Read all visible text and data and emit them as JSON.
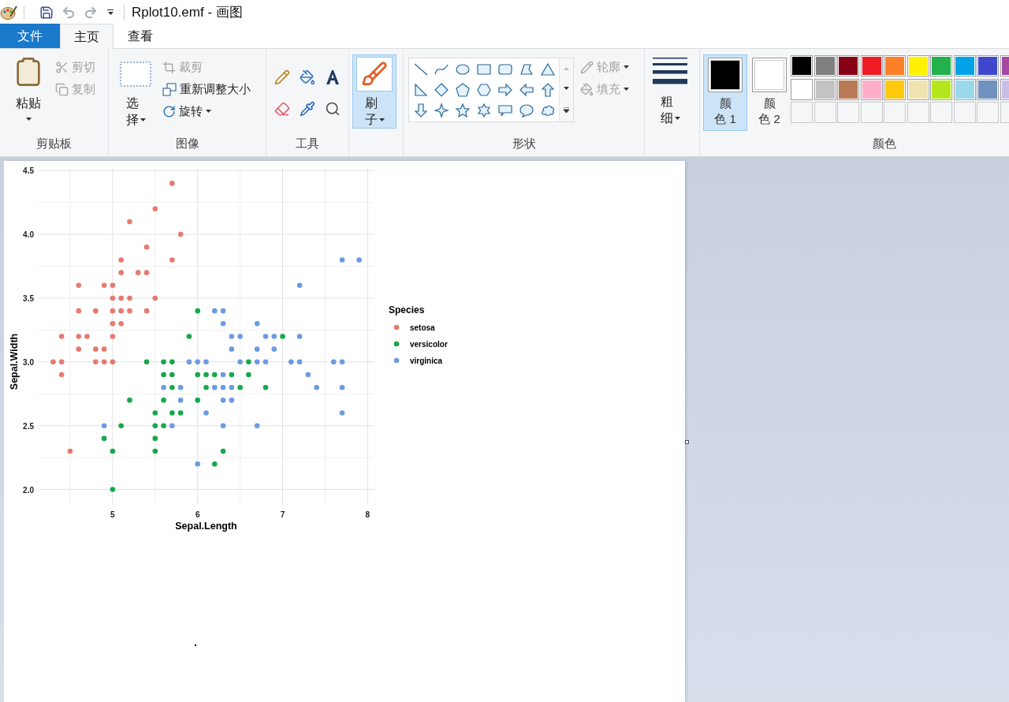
{
  "window": {
    "title": "Rplot10.emf - 画图"
  },
  "quick_access": [
    {
      "kind": "save",
      "disabled": false
    },
    {
      "kind": "undo",
      "disabled": true
    },
    {
      "kind": "redo",
      "disabled": true
    }
  ],
  "tabs": [
    {
      "label": "文件",
      "kind": "file",
      "selected": false
    },
    {
      "label": "主页",
      "kind": "tab",
      "selected": true
    },
    {
      "label": "查看",
      "kind": "tab",
      "selected": false
    }
  ],
  "clipboard": {
    "label": "剪贴板",
    "paste": "粘贴",
    "cut": {
      "label": "剪切",
      "disabled": true
    },
    "copy": {
      "label": "复制",
      "disabled": true
    }
  },
  "image": {
    "label": "图像",
    "select": "选择",
    "crop": {
      "label": "裁剪",
      "disabled": true
    },
    "resize": {
      "label": "重新调整大小",
      "disabled": false
    },
    "rotate": {
      "label": "旋转",
      "disabled": false
    }
  },
  "tools": {
    "label": "工具"
  },
  "brushes": {
    "label": "刷子",
    "selected": true
  },
  "shapes": {
    "label": "形状",
    "outline": {
      "label": "轮廓",
      "disabled": true
    },
    "fill": {
      "label": "填充",
      "disabled": true
    }
  },
  "size": {
    "label": "粗细"
  },
  "colors": {
    "label": "颜色",
    "color1": {
      "label": "颜色 1",
      "color": "#000000",
      "selected": true
    },
    "color2": {
      "label": "颜色 2",
      "color": "#ffffff",
      "selected": false
    },
    "palette": [
      {
        "color": "#000000"
      },
      {
        "color": "#7f7f7f"
      },
      {
        "color": "#880015"
      },
      {
        "color": "#ed1c24"
      },
      {
        "color": "#ff7f27"
      },
      {
        "color": "#fff200"
      },
      {
        "color": "#22b14c"
      },
      {
        "color": "#00a2e8"
      },
      {
        "color": "#3f48cc"
      },
      {
        "color": "#a349a4"
      },
      {
        "color": "#ffffff"
      },
      {
        "color": "#c3c3c3"
      },
      {
        "color": "#b97a57"
      },
      {
        "color": "#ffaec9"
      },
      {
        "color": "#ffc90e"
      },
      {
        "color": "#efe4b0"
      },
      {
        "color": "#b5e61d"
      },
      {
        "color": "#99d9ea"
      },
      {
        "color": "#7092be"
      },
      {
        "color": "#c8bfe7"
      }
    ]
  },
  "canvas": {
    "chart_data": {
      "type": "scatter",
      "grid": true,
      "legend": {
        "title": "Species"
      },
      "xlabel": "Sepal.Length",
      "ylabel": "Sepal.Width",
      "xlim": [
        4.12,
        8.08
      ],
      "ylim": [
        1.88,
        4.52
      ],
      "xticks": [
        5,
        6,
        7,
        8
      ],
      "yticks": [
        {
          "value": 2,
          "label": "2.0"
        },
        {
          "value": 2.5,
          "label": "2.5"
        },
        {
          "value": 3,
          "label": "3.0"
        },
        {
          "value": 3.5,
          "label": "3.5"
        },
        {
          "value": 4,
          "label": "4.0"
        },
        {
          "value": 4.5,
          "label": "4.5"
        }
      ],
      "series": [
        {
          "name": "setosa",
          "color": "#e8796f",
          "x": [
            5.7,
            5.5,
            5.2,
            5.8,
            5.4,
            5.1,
            5.7,
            5.1,
            5.3,
            5.4,
            4.6,
            4.9,
            5.0,
            5.0,
            5.1,
            5.2,
            5.5,
            4.6,
            4.8,
            5.0,
            5.1,
            5.2,
            5.4,
            5.0,
            5.1,
            4.4,
            4.6,
            4.7,
            5.0,
            4.6,
            4.8,
            4.9,
            4.3,
            4.4,
            4.8,
            4.9,
            5.0,
            4.4,
            4.5
          ],
          "values": [
            4.4,
            4.2,
            4.1,
            4.0,
            3.9,
            3.8,
            3.8,
            3.7,
            3.7,
            3.7,
            3.6,
            3.6,
            3.6,
            3.5,
            3.5,
            3.5,
            3.5,
            3.4,
            3.4,
            3.4,
            3.4,
            3.4,
            3.4,
            3.3,
            3.3,
            3.2,
            3.2,
            3.2,
            3.2,
            3.1,
            3.1,
            3.1,
            3.0,
            3.0,
            3.0,
            3.0,
            3.0,
            2.9,
            2.3
          ]
        },
        {
          "name": "versicolor",
          "color": "#16a84a",
          "x": [
            6.0,
            5.9,
            7.0,
            5.4,
            5.6,
            5.7,
            6.6,
            5.6,
            5.7,
            6.0,
            6.1,
            6.2,
            6.4,
            6.6,
            5.7,
            6.1,
            6.5,
            6.8,
            5.2,
            5.6,
            6.0,
            5.5,
            5.7,
            5.8,
            5.1,
            5.5,
            5.6,
            4.9,
            5.5,
            5.0,
            5.5,
            6.3,
            6.2,
            5.0
          ],
          "values": [
            3.4,
            3.2,
            3.2,
            3.0,
            3.0,
            3.0,
            3.0,
            2.9,
            2.9,
            2.9,
            2.9,
            2.9,
            2.9,
            2.9,
            2.8,
            2.8,
            2.8,
            2.8,
            2.7,
            2.7,
            2.7,
            2.6,
            2.6,
            2.6,
            2.5,
            2.5,
            2.5,
            2.4,
            2.4,
            2.3,
            2.3,
            2.3,
            2.2,
            2.0
          ]
        },
        {
          "name": "virginica",
          "color": "#6b9be3",
          "x": [
            7.7,
            7.9,
            7.2,
            6.2,
            6.3,
            6.3,
            6.7,
            6.4,
            6.5,
            6.8,
            6.9,
            7.2,
            6.4,
            6.7,
            6.9,
            5.9,
            6.0,
            6.1,
            6.5,
            6.7,
            6.8,
            7.1,
            7.2,
            7.6,
            7.7,
            6.3,
            7.3,
            5.6,
            5.8,
            6.2,
            6.3,
            6.4,
            7.4,
            7.7,
            5.8,
            6.3,
            6.4,
            6.1,
            7.7,
            4.9,
            5.7,
            6.3,
            6.7,
            6.0
          ],
          "values": [
            3.8,
            3.8,
            3.6,
            3.4,
            3.4,
            3.3,
            3.3,
            3.2,
            3.2,
            3.2,
            3.2,
            3.2,
            3.1,
            3.1,
            3.1,
            3.0,
            3.0,
            3.0,
            3.0,
            3.0,
            3.0,
            3.0,
            3.0,
            3.0,
            3.0,
            2.9,
            2.9,
            2.8,
            2.8,
            2.8,
            2.8,
            2.8,
            2.8,
            2.8,
            2.7,
            2.7,
            2.7,
            2.6,
            2.6,
            2.5,
            2.5,
            2.5,
            2.5,
            2.2
          ]
        }
      ]
    }
  }
}
